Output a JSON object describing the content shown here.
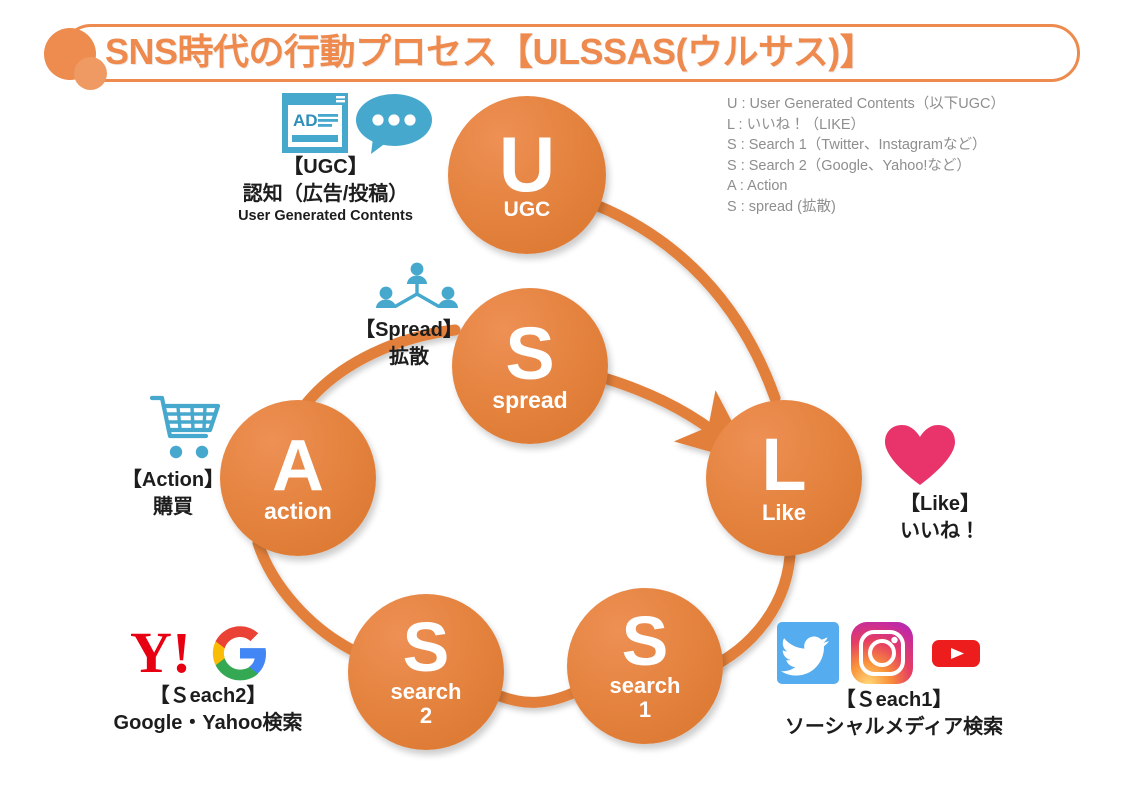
{
  "title": {
    "text": "SNS時代の行動プロセス【ULSSAS(ウルサス)】",
    "accent_color": "#EE8A4D"
  },
  "legend": {
    "lines": [
      "U : User Generated Contents（以下UGC）",
      "L : いいね！（LIKE）",
      "S : Search 1（Twitter、Instagramなど）",
      "S : Search 2（Google、Yahoo!など）",
      "A : Action",
      "S : spread (拡散)"
    ],
    "color": "#8E8E8E"
  },
  "nodes": [
    {
      "id": "u",
      "letter": "U",
      "caption": "UGC"
    },
    {
      "id": "spread",
      "letter": "S",
      "caption": "spread"
    },
    {
      "id": "l",
      "letter": "L",
      "caption": "Like"
    },
    {
      "id": "a",
      "letter": "A",
      "caption": "action"
    },
    {
      "id": "search1",
      "letter": "S",
      "caption": "search\n1"
    },
    {
      "id": "search2",
      "letter": "S",
      "caption": "search\n2"
    }
  ],
  "node_captions": {
    "u": "UGC",
    "spread": "spread",
    "l": "Like",
    "a": "action",
    "search1_line1": "search",
    "search1_line2": "1",
    "search2_line1": "search",
    "search2_line2": "2"
  },
  "node_letters": {
    "u": "U",
    "spread": "S",
    "l": "L",
    "a": "A",
    "search1": "S",
    "search2": "S"
  },
  "labels": {
    "ugc": {
      "line1": "【UGC】",
      "line2": "認知（広告/投稿）",
      "line3": "User Generated Contents"
    },
    "spread": {
      "line1": "【Spread】",
      "line2": "拡散"
    },
    "action": {
      "line1": "【Action】",
      "line2": "購買"
    },
    "like": {
      "line1": "【Like】",
      "line2": "いいね！"
    },
    "search1": {
      "line1": "【Ｓeach1】",
      "line2": "ソーシャルメディア検索"
    },
    "search2": {
      "line1": "【Ｓeach2】",
      "line2": "Google・Yahoo検索"
    }
  },
  "icons": {
    "ugc_ad": "ad-card-icon",
    "ugc_bubble": "speech-bubble-icon",
    "spread": "people-network-icon",
    "action": "shopping-cart-icon",
    "like": "heart-icon",
    "search1": [
      "twitter-icon",
      "instagram-icon",
      "youtube-icon"
    ],
    "search2": [
      "yahoo-icon",
      "google-icon"
    ]
  },
  "colors": {
    "orange": "#E2803A",
    "orange_light": "#EE9055",
    "orange_dark": "#D9762F",
    "title_orange": "#EE8A4D",
    "icon_blue": "#47A8CE",
    "heart_pink": "#E8336B",
    "yahoo_red": "#E60012",
    "google_blue": "#4285F4",
    "google_red": "#EA4335",
    "google_yellow": "#FBBC05",
    "google_green": "#34A853",
    "twitter_blue": "#55ACEE",
    "youtube_red": "#EE1D1D"
  }
}
